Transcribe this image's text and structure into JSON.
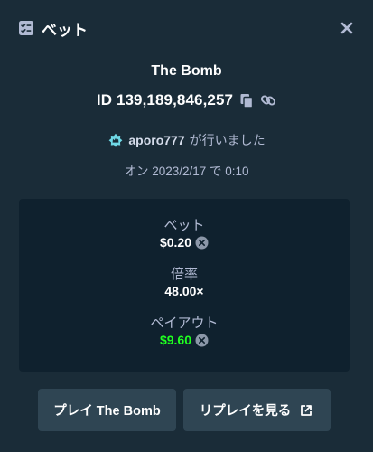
{
  "header": {
    "title": "ベット",
    "icon": "bet-slip-icon",
    "close_icon": "close-icon"
  },
  "bet": {
    "game_title": "The Bomb",
    "id_label": "ID 139,189,846,257",
    "placed_by_user": "aporo777",
    "placed_by_suffix": "が行いました",
    "date_text": "オン 2023/2/17 で 0:10"
  },
  "stats": {
    "bet_label": "ベット",
    "bet_value": "$0.20",
    "multiplier_label": "倍率",
    "multiplier_value": "48.00×",
    "payout_label": "ペイアウト",
    "payout_value": "$9.60"
  },
  "buttons": {
    "play_label": "プレイ The Bomb",
    "replay_label": "リプレイを見る"
  },
  "colors": {
    "background": "#1a2c38",
    "card": "#0f212e",
    "button": "#2f4553",
    "muted_text": "#b1bad3",
    "payout_green": "#1fff20"
  }
}
